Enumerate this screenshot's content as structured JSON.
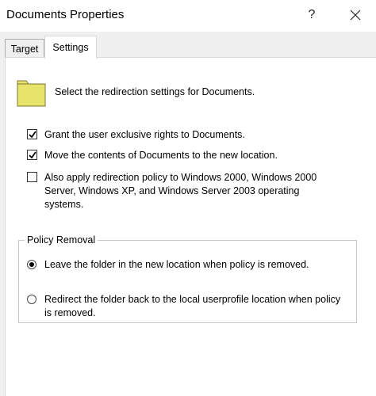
{
  "window": {
    "title": "Documents Properties",
    "help_label": "?"
  },
  "tabs": [
    {
      "label": "Target",
      "selected": false
    },
    {
      "label": "Settings",
      "selected": true
    }
  ],
  "settings": {
    "intro_text": "Select the redirection settings for Documents.",
    "folder_icon": "folder-icon",
    "options": [
      {
        "label": "Grant the user exclusive rights to Documents.",
        "checked": true
      },
      {
        "label": "Move the contents of Documents to the new location.",
        "checked": true
      },
      {
        "label": "Also apply redirection policy to Windows 2000, Windows 2000 Server, Windows XP, and Windows Server 2003 operating systems.",
        "checked": false
      }
    ],
    "policy_removal": {
      "legend": "Policy Removal",
      "options": [
        {
          "label": "Leave the folder in the new location when policy is removed.",
          "selected": true
        },
        {
          "label": "Redirect the folder back to the local userprofile location when policy is removed.",
          "selected": false
        }
      ]
    }
  },
  "colors": {
    "folder_fill": "#e8e36a",
    "folder_stroke": "#7a7a3a",
    "title_bar": "#ffffff",
    "dialog_bg": "#f0f0f0"
  }
}
